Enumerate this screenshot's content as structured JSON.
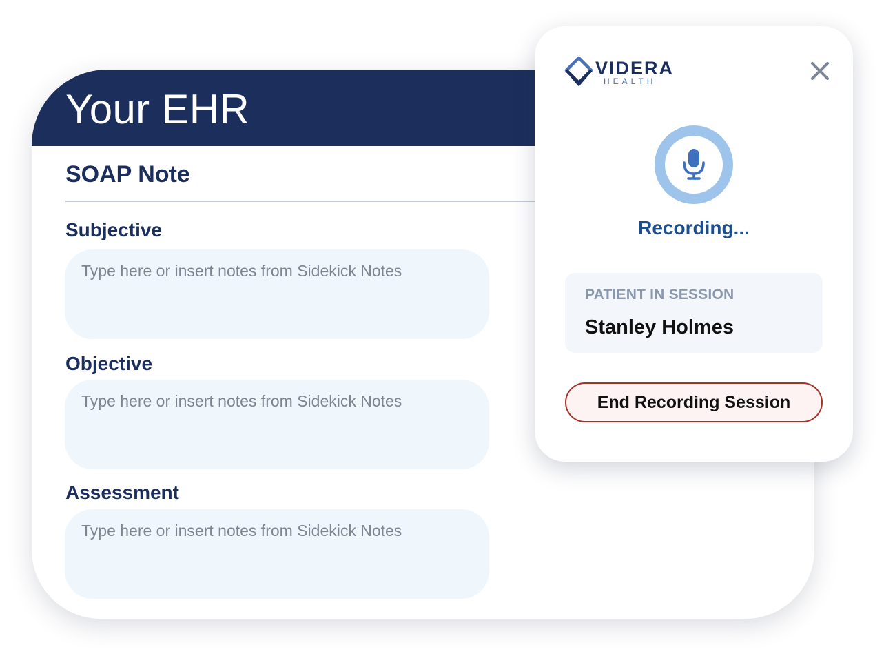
{
  "ehr": {
    "title": "Your EHR",
    "note_title": "SOAP Note",
    "sections": [
      {
        "label": "Subjective",
        "value": "",
        "placeholder": "Type here or insert notes from Sidekick Notes"
      },
      {
        "label": "Objective",
        "value": "",
        "placeholder": "Type here or insert notes from Sidekick Notes"
      },
      {
        "label": "Assessment",
        "value": "",
        "placeholder": "Type here or insert notes from Sidekick Notes"
      }
    ]
  },
  "recorder": {
    "logo": {
      "name": "VIDERA",
      "sub": "HEALTH",
      "icon": "videra-diamond-logo"
    },
    "close_icon": "close-icon",
    "mic_icon": "microphone-icon",
    "status": "Recording...",
    "patient_label": "PATIENT IN SESSION",
    "patient_name": "Stanley Holmes",
    "end_button_label": "End Recording Session"
  },
  "colors": {
    "navy": "#1c2f5c",
    "accent_blue": "#1a4e8f",
    "mic_ring": "#9fc4eb",
    "mic": "#3f6fbf",
    "field_bg": "#f0f7fc",
    "end_border": "#a3332b",
    "end_bg": "#fdf3f2",
    "patient_label": "#8a98ad"
  }
}
